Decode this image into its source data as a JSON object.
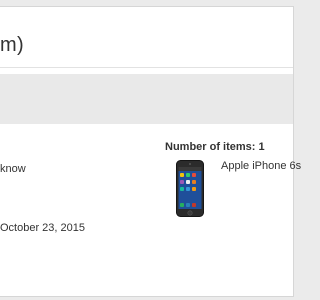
{
  "header": {
    "title_partial": "m)"
  },
  "order_summary": {
    "items_count_label": "Number of items: 1",
    "line_1_partial": "know",
    "date_partial": "October 23, 2015"
  },
  "product": {
    "name_partial": "Apple iPhone 6s",
    "image_icon": "iphone-icon"
  }
}
